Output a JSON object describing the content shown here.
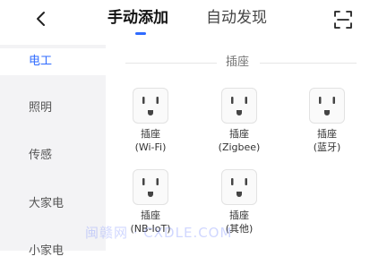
{
  "header": {
    "tabs": [
      {
        "label": "手动添加",
        "active": true
      },
      {
        "label": "自动发现",
        "active": false
      }
    ],
    "back_icon": "chevron-left-icon",
    "scan_icon": "scan-icon",
    "accent": "#2f6bff"
  },
  "sidebar": {
    "items": [
      {
        "label": "电工",
        "active": true
      },
      {
        "label": "照明",
        "active": false
      },
      {
        "label": "传感",
        "active": false
      },
      {
        "label": "大家电",
        "active": false
      },
      {
        "label": "小家电",
        "active": false
      }
    ]
  },
  "section": {
    "title": "插座"
  },
  "devices": [
    {
      "line1": "插座",
      "line2": "(Wi-Fi)",
      "icon": "socket-icon"
    },
    {
      "line1": "插座",
      "line2": "(Zigbee)",
      "icon": "socket-icon"
    },
    {
      "line1": "插座",
      "line2": "(蓝牙)",
      "icon": "socket-icon"
    },
    {
      "line1": "插座",
      "line2": "(NB-IoT)",
      "icon": "socket-icon"
    },
    {
      "line1": "插座",
      "line2": "(其他)",
      "icon": "socket-icon"
    }
  ],
  "watermark": "闽赣网 · CXDLE.COM"
}
